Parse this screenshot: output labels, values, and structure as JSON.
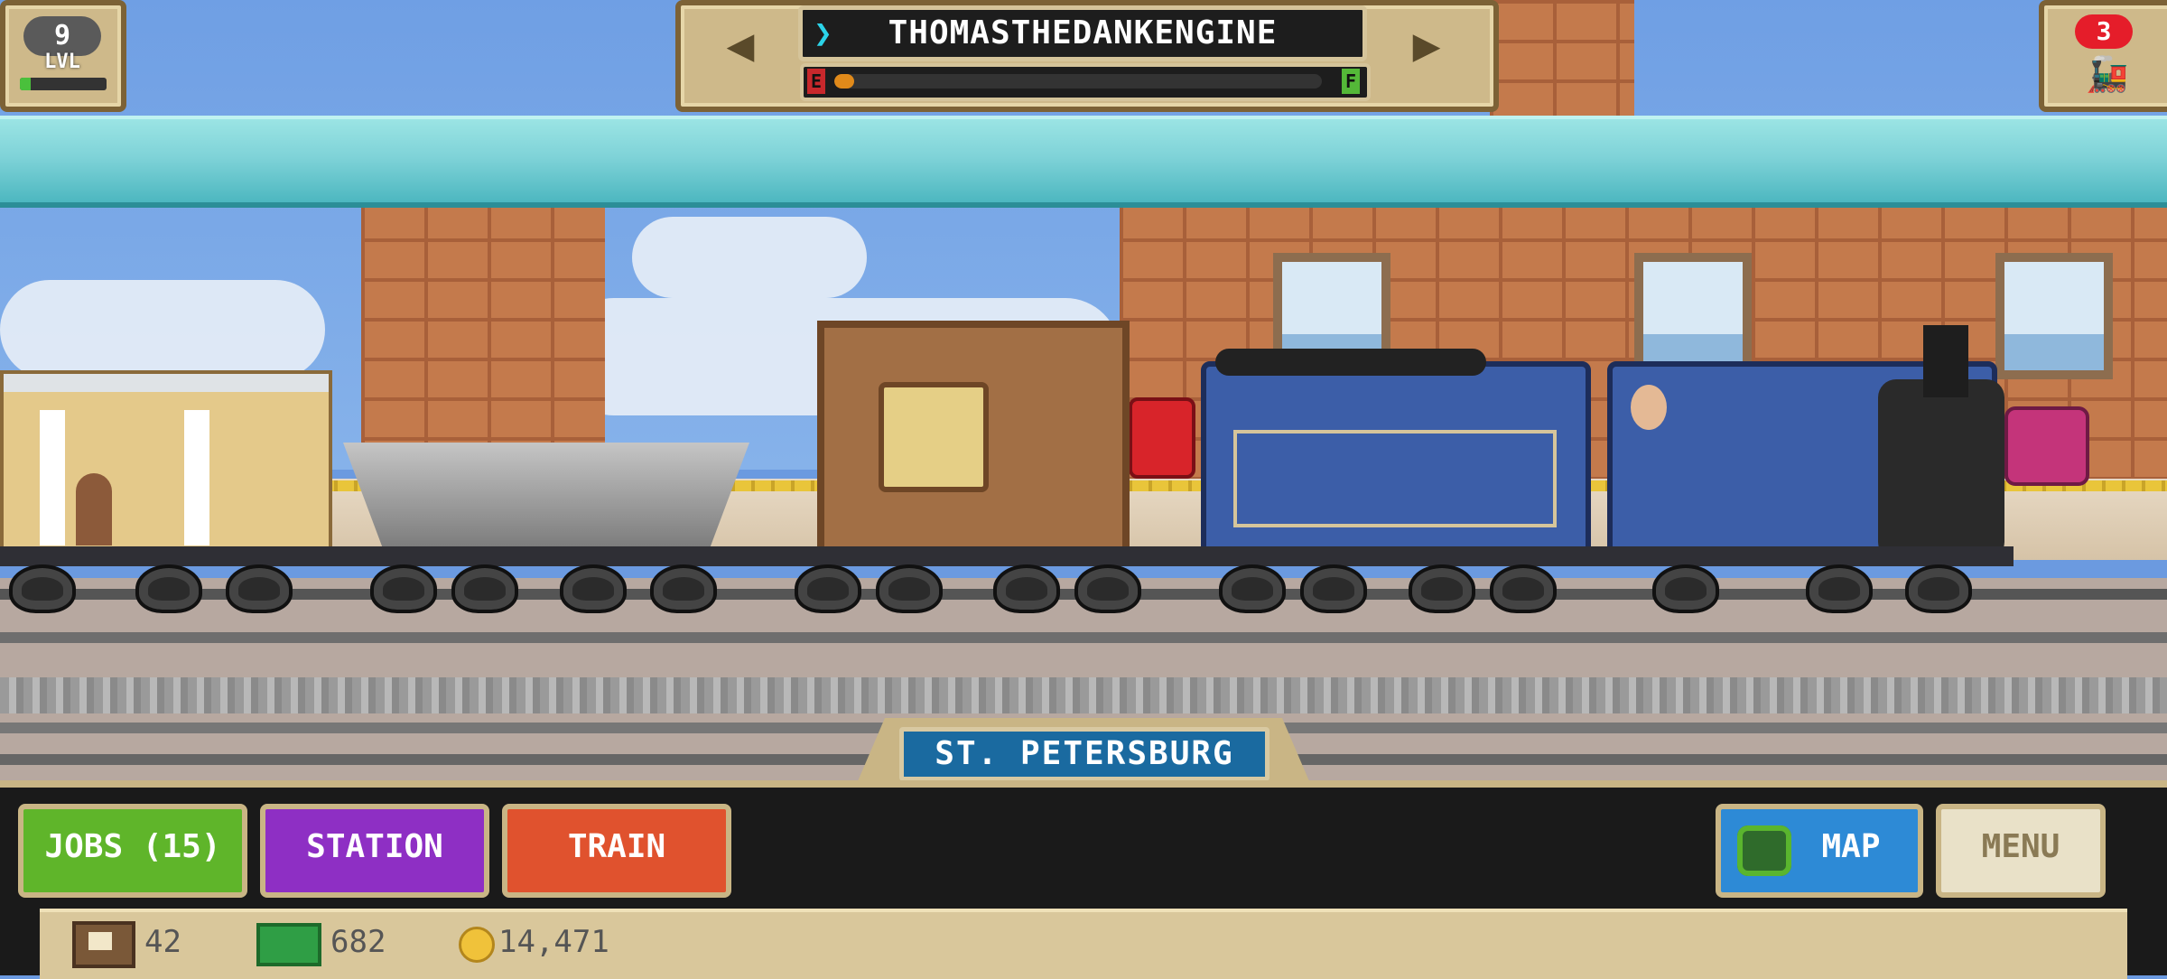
{
  "player": {
    "level": "9",
    "level_label": "LVL",
    "xp_fraction": 0.12
  },
  "train": {
    "name": "THOMASTHEDANKENGINE",
    "fuel_empty_label": "E",
    "fuel_full_label": "F",
    "fuel_fraction": 0.04
  },
  "badge": {
    "count": "3"
  },
  "station": {
    "name": "ST. PETERSBURG"
  },
  "buttons": {
    "jobs": "JOBS (15)",
    "station": "STATION",
    "train": "TRAIN",
    "map": "MAP",
    "menu": "MENU"
  },
  "resources": {
    "crates": "42",
    "cash": "682",
    "coins": "14,471"
  },
  "colors": {
    "jobs": "#5fb52a",
    "station": "#8e2fc4",
    "train": "#e0522e",
    "map": "#2d8ad6",
    "menu": "#e9e1c8"
  }
}
